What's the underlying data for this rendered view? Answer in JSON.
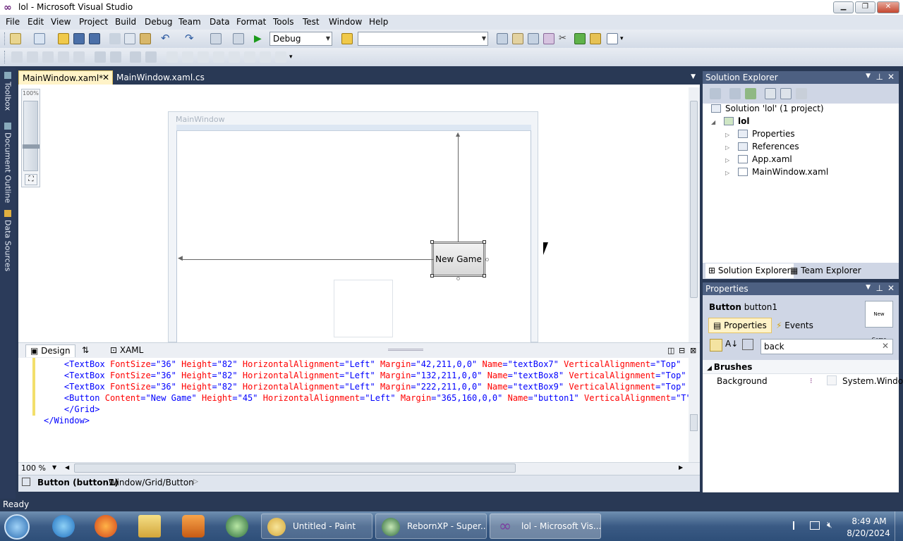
{
  "window": {
    "title": "lol - Microsoft Visual Studio",
    "logo": "∞"
  },
  "menu": [
    "File",
    "Edit",
    "View",
    "Project",
    "Build",
    "Debug",
    "Team",
    "Data",
    "Format",
    "Tools",
    "Test",
    "Window",
    "Help"
  ],
  "toolbar": {
    "config": "Debug",
    "platform": ""
  },
  "left_rail": [
    "Toolbox",
    "Document Outline",
    "Data Sources"
  ],
  "doc_tabs": [
    {
      "label": "MainWindow.xaml*",
      "active": true
    },
    {
      "label": "MainWindow.xaml.cs",
      "active": false
    }
  ],
  "designer": {
    "zoom_label": "100%",
    "window_caption": "MainWindow",
    "button_content": "New Game"
  },
  "split_tabs": {
    "design": "Design",
    "swap": "⇅",
    "xaml": "XAML"
  },
  "xaml_lines": [
    {
      "indent": "        ",
      "tag": "<TextBox",
      "attrs": [
        [
          "FontSize",
          "36"
        ],
        [
          "Height",
          "82"
        ],
        [
          "HorizontalAlignment",
          "Left"
        ],
        [
          "Margin",
          "42,211,0,0"
        ],
        [
          "Name",
          "textBox7"
        ],
        [
          "VerticalAlignment",
          "Top\""
        ]
      ]
    },
    {
      "indent": "        ",
      "tag": "<TextBox",
      "attrs": [
        [
          "FontSize",
          "36"
        ],
        [
          "Height",
          "82"
        ],
        [
          "HorizontalAlignment",
          "Left"
        ],
        [
          "Margin",
          "132,211,0,0"
        ],
        [
          "Name",
          "textBox8"
        ],
        [
          "VerticalAlignment",
          "Top\""
        ]
      ]
    },
    {
      "indent": "        ",
      "tag": "<TextBox",
      "attrs": [
        [
          "FontSize",
          "36"
        ],
        [
          "Height",
          "82"
        ],
        [
          "HorizontalAlignment",
          "Left"
        ],
        [
          "Margin",
          "222,211,0,0"
        ],
        [
          "Name",
          "textBox9"
        ],
        [
          "VerticalAlignment",
          "Top\""
        ]
      ]
    },
    {
      "indent": "        ",
      "tag": "<Button",
      "attrs": [
        [
          "Content",
          "New Game"
        ],
        [
          "Height",
          "45"
        ],
        [
          "HorizontalAlignment",
          "Left"
        ],
        [
          "Margin",
          "365,160,0,0"
        ],
        [
          "Name",
          "button1"
        ],
        [
          "VerticalAlignment",
          "T"
        ]
      ]
    }
  ],
  "xaml_close": [
    "    </Grid>",
    "</Window>"
  ],
  "zoom_combo": "100 %",
  "breadcrumb": {
    "element": "Button (button1)",
    "path": "Window/Grid/Button"
  },
  "solution_explorer": {
    "title": "Solution Explorer",
    "solution": "Solution 'lol' (1 project)",
    "project": "lol",
    "items": [
      "Properties",
      "References",
      "App.xaml",
      "MainWindow.xaml"
    ],
    "bottom_tabs": [
      "Solution Explorer",
      "Team Explorer"
    ]
  },
  "properties": {
    "title": "Properties",
    "type": "Button",
    "name": "button1",
    "preview": "New Game",
    "tabs": [
      "Properties",
      "Events"
    ],
    "search": "back",
    "category": "Brushes",
    "prop_name": "Background",
    "prop_value": "System.Windo"
  },
  "status": "Ready",
  "taskbar": {
    "apps": [
      "Untitled - Paint",
      "RebornXP - Super...",
      "lol - Microsoft Vis..."
    ],
    "time": "8:49 AM",
    "date": "8/20/2024"
  },
  "colors": {
    "xaml_tag": "#a31515",
    "xaml_attr": "#ff0000",
    "xaml_val": "#0000ff",
    "accent": "#293955"
  }
}
